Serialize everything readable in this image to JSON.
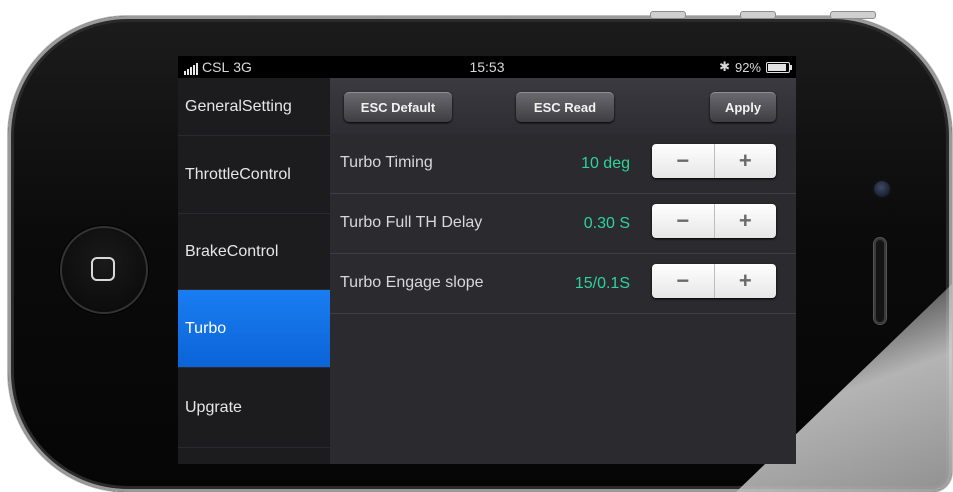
{
  "status_bar": {
    "carrier": "CSL",
    "network": "3G",
    "time": "15:53",
    "bluetooth_icon": "✱",
    "battery_percent": "92%",
    "battery_level": 0.92
  },
  "sidebar": {
    "items": [
      {
        "label": "GeneralSetting",
        "active": false
      },
      {
        "label": "ThrottleControl",
        "active": false
      },
      {
        "label": "BrakeControl",
        "active": false
      },
      {
        "label": "Turbo",
        "active": true
      },
      {
        "label": "Upgrate",
        "active": false
      }
    ]
  },
  "toolbar": {
    "esc_default_label": "ESC Default",
    "esc_read_label": "ESC Read",
    "apply_label": "Apply"
  },
  "settings": [
    {
      "label": "Turbo Timing",
      "value": "10  deg",
      "minus": "−",
      "plus": "+"
    },
    {
      "label": "Turbo Full TH Delay",
      "value": "0.30  S",
      "minus": "−",
      "plus": "+"
    },
    {
      "label": "Turbo Engage slope",
      "value": "15/0.1S",
      "minus": "−",
      "plus": "+"
    }
  ],
  "colors": {
    "accent_active": "#0b6fe6",
    "value_green": "#2fd39a"
  }
}
